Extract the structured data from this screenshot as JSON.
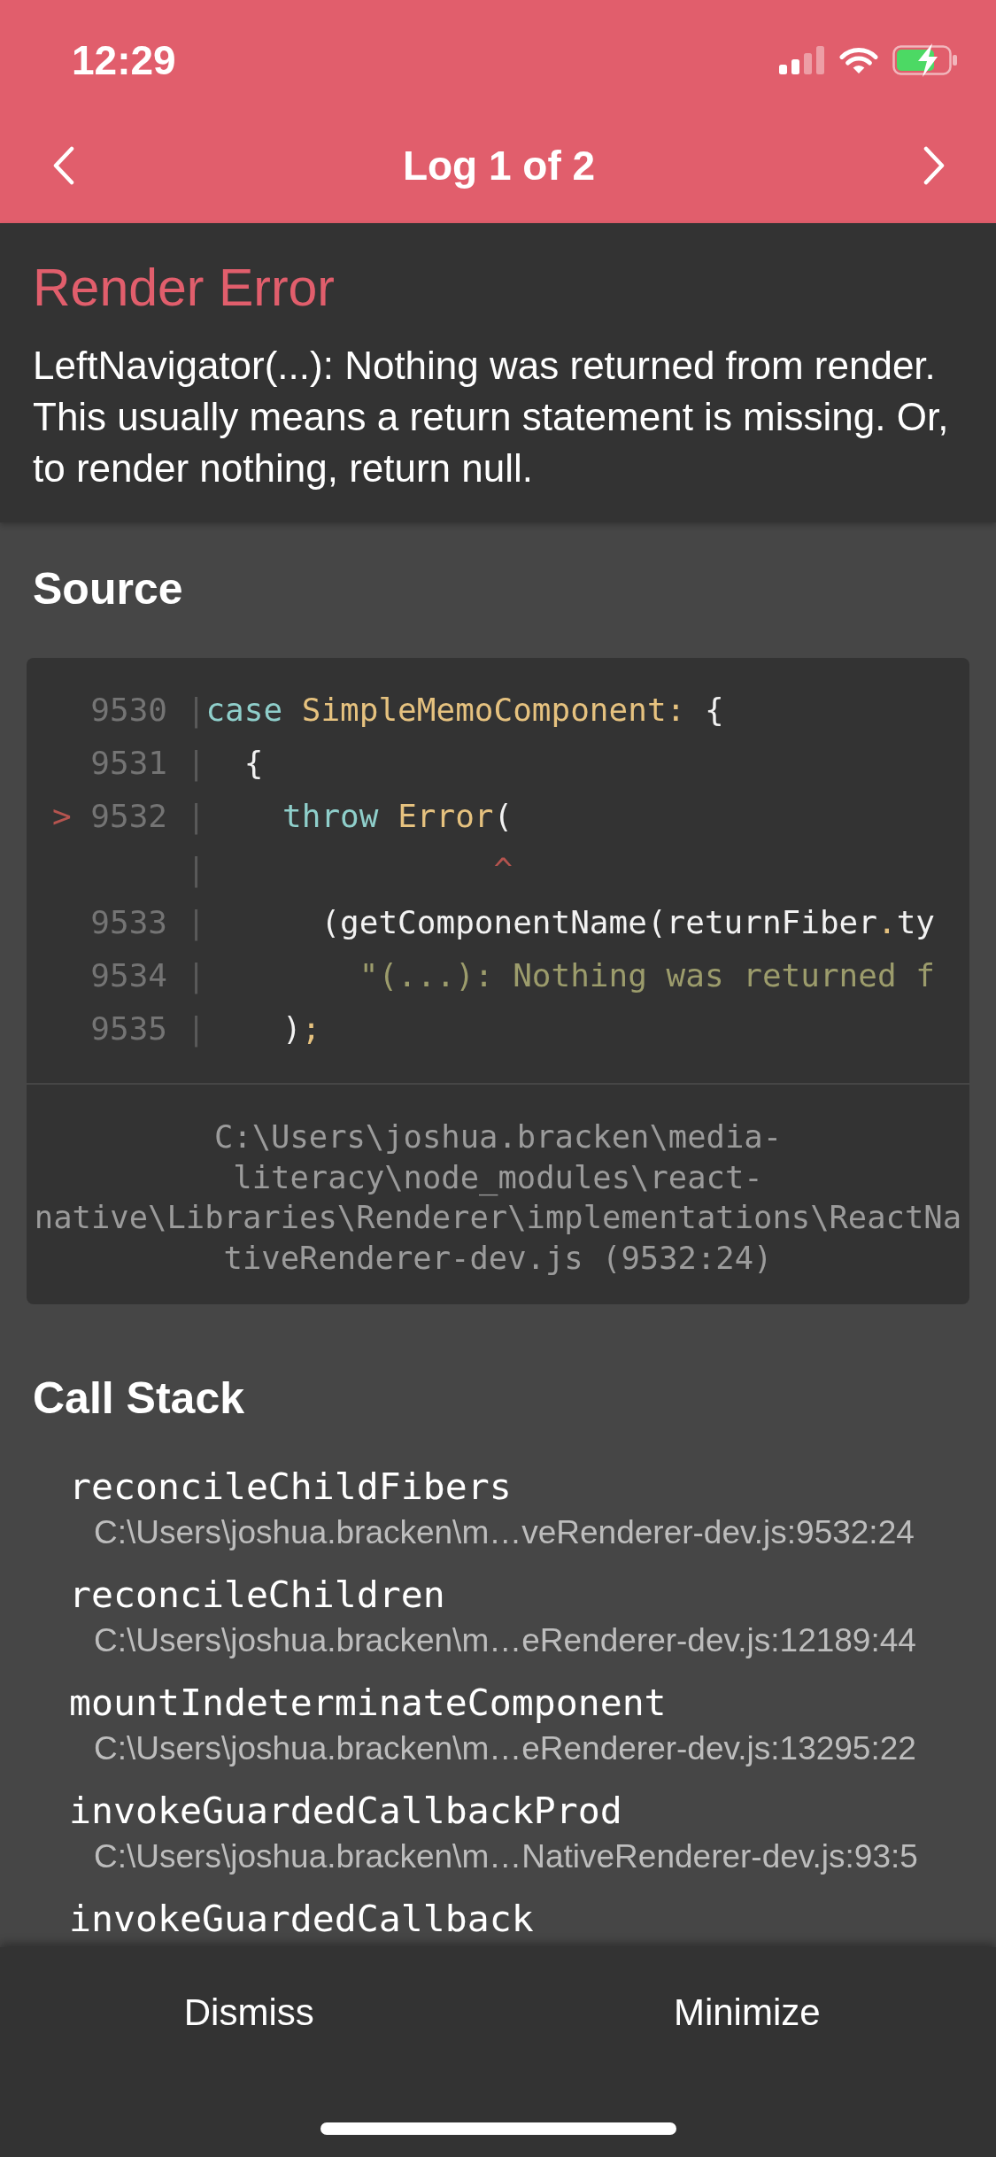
{
  "status_bar": {
    "time": "12:29"
  },
  "nav": {
    "title": "Log 1 of 2"
  },
  "error": {
    "title": "Render Error",
    "message": "LeftNavigator(...): Nothing was returned from render. This usually means a return statement is missing. Or, to render nothing, return null."
  },
  "source": {
    "heading": "Source",
    "code_frame": {
      "lines": [
        {
          "number": "9530",
          "gutter": "|",
          "tokens": [
            {
              "kind": "keyword",
              "text": "case"
            },
            {
              "kind": "name",
              "text": " SimpleMemoComponent:"
            },
            {
              "kind": "plain",
              "text": " {"
            }
          ]
        },
        {
          "number": "9531",
          "gutter": "|",
          "tokens": [
            {
              "kind": "plain",
              "text": "  {"
            }
          ]
        },
        {
          "marker": ">",
          "number": "9532",
          "gutter": "|",
          "tokens": [
            {
              "kind": "keyword",
              "text": "    throw"
            },
            {
              "kind": "name",
              "text": " Error"
            },
            {
              "kind": "plain",
              "text": "("
            }
          ]
        },
        {
          "gutter": "|",
          "tokens": [
            {
              "kind": "caret",
              "text": "               ^"
            }
          ]
        },
        {
          "number": "9533",
          "gutter": "|",
          "tokens": [
            {
              "kind": "plain",
              "text": "      (getComponentName(returnFiber"
            },
            {
              "kind": "punct",
              "text": "."
            },
            {
              "kind": "plain",
              "text": "ty"
            }
          ]
        },
        {
          "number": "9534",
          "gutter": "|",
          "tokens": [
            {
              "kind": "string",
              "text": "        \"(...): Nothing was returned f"
            }
          ]
        },
        {
          "number": "9535",
          "gutter": "|",
          "tokens": [
            {
              "kind": "plain",
              "text": "    )"
            },
            {
              "kind": "punct",
              "text": ";"
            }
          ]
        }
      ],
      "file": "C:\\Users\\joshua.bracken\\media-literacy\\node_modules\\react-native\\Libraries\\Renderer\\implementations\\ReactNativeRenderer-dev.js (9532:24)"
    }
  },
  "call_stack": {
    "heading": "Call Stack",
    "frames": [
      {
        "function": "reconcileChildFibers",
        "location": "C:\\Users\\joshua.bracken\\m…veRenderer-dev.js:9532:24"
      },
      {
        "function": "reconcileChildren",
        "location": "C:\\Users\\joshua.bracken\\m…eRenderer-dev.js:12189:44"
      },
      {
        "function": "mountIndeterminateComponent",
        "location": "C:\\Users\\joshua.bracken\\m…eRenderer-dev.js:13295:22"
      },
      {
        "function": "invokeGuardedCallbackProd",
        "location": "C:\\Users\\joshua.bracken\\m…NativeRenderer-dev.js:93:5"
      },
      {
        "function": "invokeGuardedCallback"
      }
    ]
  },
  "actions": [
    {
      "label": "Dismiss"
    },
    {
      "label": "Minimize"
    }
  ]
}
